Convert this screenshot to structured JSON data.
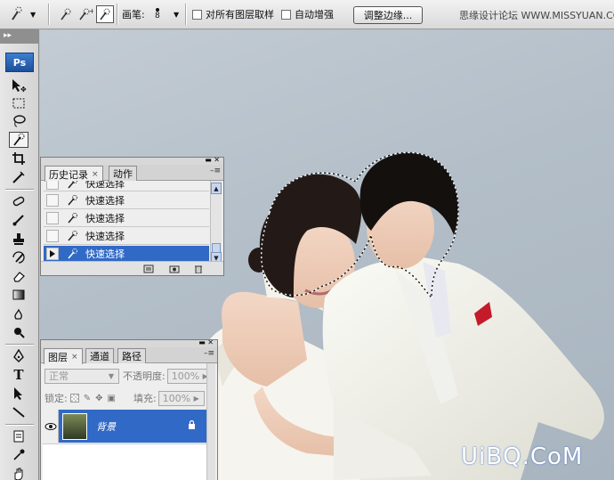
{
  "options_bar": {
    "brush_label": "画笔:",
    "brush_size": "8",
    "sample_all_layers": "对所有图层取样",
    "auto_enhance": "自动增强",
    "refine_edge_button": "调整边缘...",
    "watermark": "思缘设计论坛 WWW.MISSYUAN.COM"
  },
  "toolbox": {
    "header": "▸▸",
    "logo": "Ps"
  },
  "history_panel": {
    "tabs": [
      {
        "label": "历史记录",
        "close": "×"
      },
      {
        "label": "动作"
      }
    ],
    "menu": "–≡",
    "items": [
      {
        "label": "快速选择",
        "selected": false
      },
      {
        "label": "快速选择",
        "selected": false
      },
      {
        "label": "快速选择",
        "selected": false
      },
      {
        "label": "快速选择",
        "selected": false
      },
      {
        "label": "快速选择",
        "selected": true
      }
    ]
  },
  "layers_panel": {
    "tabs": [
      {
        "label": "图层",
        "close": "×"
      },
      {
        "label": "通道"
      },
      {
        "label": "路径"
      }
    ],
    "menu": "–≡",
    "blend_mode": "正常",
    "opacity_label": "不透明度:",
    "opacity_value": "100%",
    "lock_label": "锁定:",
    "fill_label": "填充:",
    "fill_value": "100%",
    "layer_name": "背景"
  },
  "watermark_bottom": "UiBQ.CoM",
  "colors": {
    "selection": "#3169c6",
    "panel": "#eeeeee",
    "ps_logo": "#2d68bd"
  }
}
